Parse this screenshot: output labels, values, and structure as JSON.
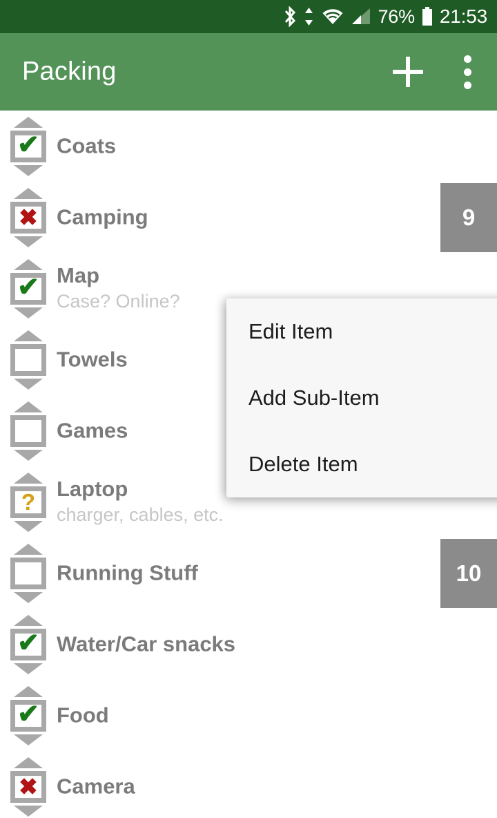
{
  "statusbar": {
    "icons": [
      "bluetooth-icon",
      "data-transfer-icon",
      "wifi-icon",
      "cellular-signal-icon"
    ],
    "battery_percent": "76%",
    "battery_icon": "battery-icon",
    "time": "21:53"
  },
  "appbar": {
    "title": "Packing",
    "add_label": "+",
    "add_icon": "plus-icon",
    "overflow_icon": "more-vert-icon",
    "background": "#539358",
    "statusbar_background": "#1f5b25"
  },
  "list": {
    "items": [
      {
        "title": "Coats",
        "subtitle": "",
        "state": "checked",
        "mark": "✔",
        "badge": ""
      },
      {
        "title": "Camping",
        "subtitle": "",
        "state": "crossed",
        "mark": "✖",
        "badge": "9"
      },
      {
        "title": "Map",
        "subtitle": "Case? Online?",
        "state": "checked",
        "mark": "✔",
        "badge": ""
      },
      {
        "title": "Towels",
        "subtitle": "",
        "state": "unchecked",
        "mark": "",
        "badge": ""
      },
      {
        "title": "Games",
        "subtitle": "",
        "state": "unchecked",
        "mark": "",
        "badge": ""
      },
      {
        "title": "Laptop",
        "subtitle": "charger, cables, etc.",
        "state": "question",
        "mark": "?",
        "badge": ""
      },
      {
        "title": "Running Stuff",
        "subtitle": "",
        "state": "unchecked",
        "mark": "",
        "badge": "10"
      },
      {
        "title": "Water/Car snacks",
        "subtitle": "",
        "state": "checked",
        "mark": "✔",
        "badge": ""
      },
      {
        "title": "Food",
        "subtitle": "",
        "state": "checked",
        "mark": "✔",
        "badge": ""
      },
      {
        "title": "Camera",
        "subtitle": "",
        "state": "crossed",
        "mark": "✖",
        "badge": ""
      }
    ],
    "colors": {
      "title": "#7b7b7b",
      "subtitle": "#c6c6c6",
      "check": "#1a7a1a",
      "cross": "#b01414",
      "question": "#d3a017",
      "icon_frame": "#a8a8a8",
      "badge_background": "#8b8b8b"
    }
  },
  "context_menu": {
    "items": [
      {
        "label": "Edit Item"
      },
      {
        "label": "Add Sub-Item"
      },
      {
        "label": "Delete Item"
      }
    ]
  }
}
